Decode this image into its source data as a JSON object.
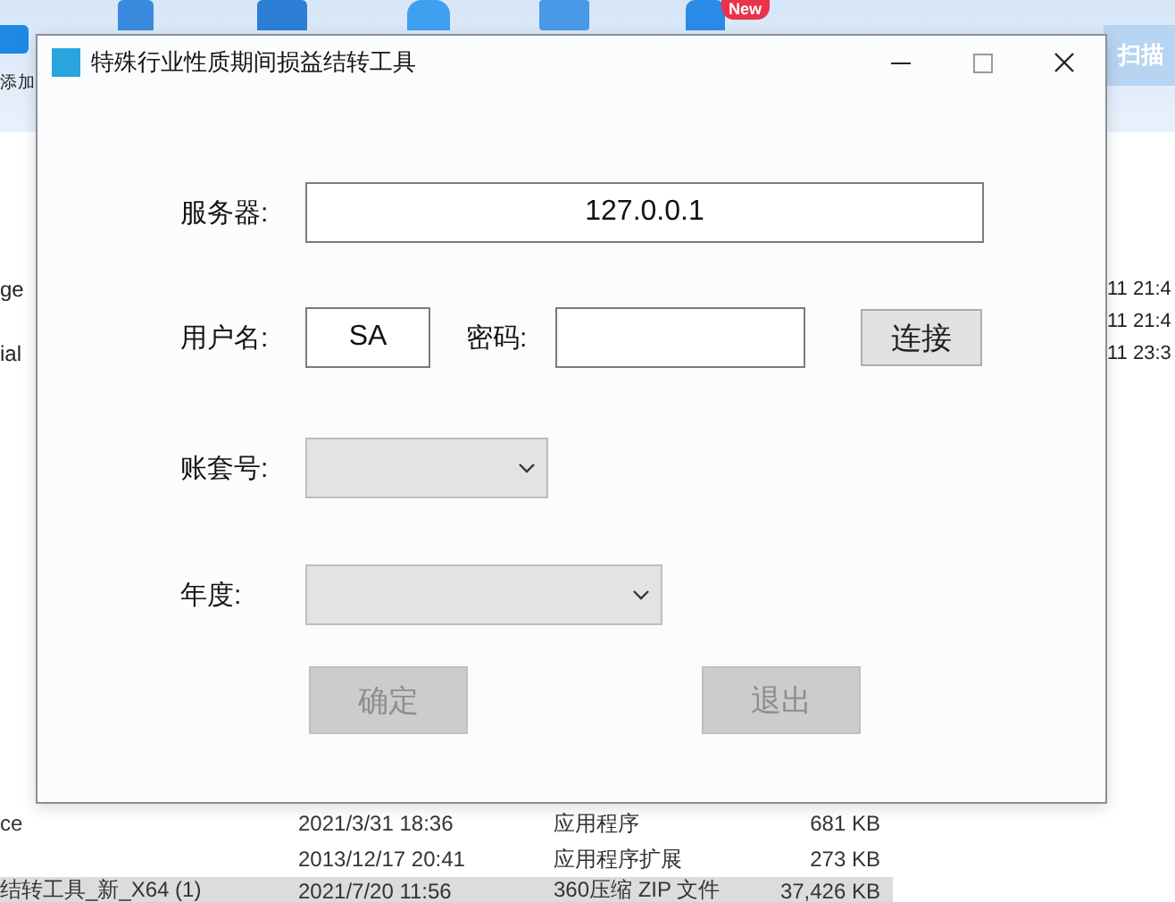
{
  "background_app": {
    "toolbar": {
      "add_label": "添加",
      "new_badge": "New",
      "scan_label": "扫描"
    },
    "list_fragments": [
      {
        "name": "ge",
        "date": "11 21:4"
      },
      {
        "date": "11 21:4"
      },
      {
        "name": "ial",
        "date": "11 23:3"
      }
    ],
    "rows": [
      {
        "name": "ce",
        "date": "2021/3/31 18:36",
        "type": "应用程序",
        "size": "681 KB",
        "selected": false
      },
      {
        "date": "2013/12/17 20:41",
        "type": "应用程序扩展",
        "size": "273 KB",
        "selected": false
      },
      {
        "name": "结转工具_新_X64 (1)",
        "date": "2021/7/20 11:56",
        "type": "360压缩 ZIP 文件",
        "size": "37,426 KB",
        "selected": true
      }
    ]
  },
  "dialog": {
    "title": "特殊行业性质期间损益结转工具",
    "server": {
      "label": "服务器:",
      "value": "127.0.0.1"
    },
    "user": {
      "label": "用户名:",
      "value": "SA"
    },
    "password": {
      "label": "密码:"
    },
    "connect_button": {
      "label": "连接",
      "disabled": false
    },
    "account_set": {
      "label": "账套号:",
      "disabled": false
    },
    "year": {
      "label": "年度:",
      "disabled": false
    },
    "buttons": [
      {
        "label": "确定",
        "disabled": true
      },
      {
        "label": "退出",
        "disabled": true
      }
    ]
  }
}
